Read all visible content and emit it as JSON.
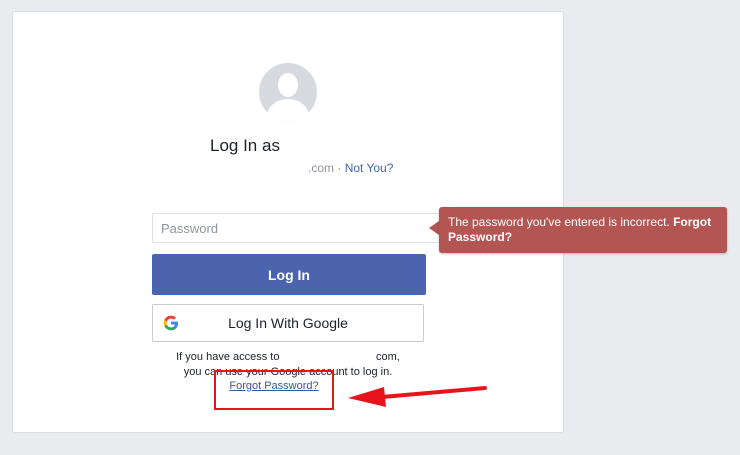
{
  "login": {
    "title": "Log In as",
    "account_suffix": ".com",
    "separator": " · ",
    "not_you": "Not You?",
    "password_placeholder": "Password",
    "login_button": "Log In",
    "google_button": "Log In With Google",
    "helper_prefix": "If you have access to ",
    "helper_suffix": "com,",
    "helper_line2": "you can use your Google account to log in.",
    "forgot_password": "Forgot Password?"
  },
  "tooltip": {
    "message": "The password you've entered is incorrect. ",
    "link": "Forgot Password?"
  },
  "colors": {
    "primary_button": "#4b64ad",
    "error_tooltip": "#b35552",
    "highlight_box": "#e8141c",
    "link": "#4267b2"
  }
}
